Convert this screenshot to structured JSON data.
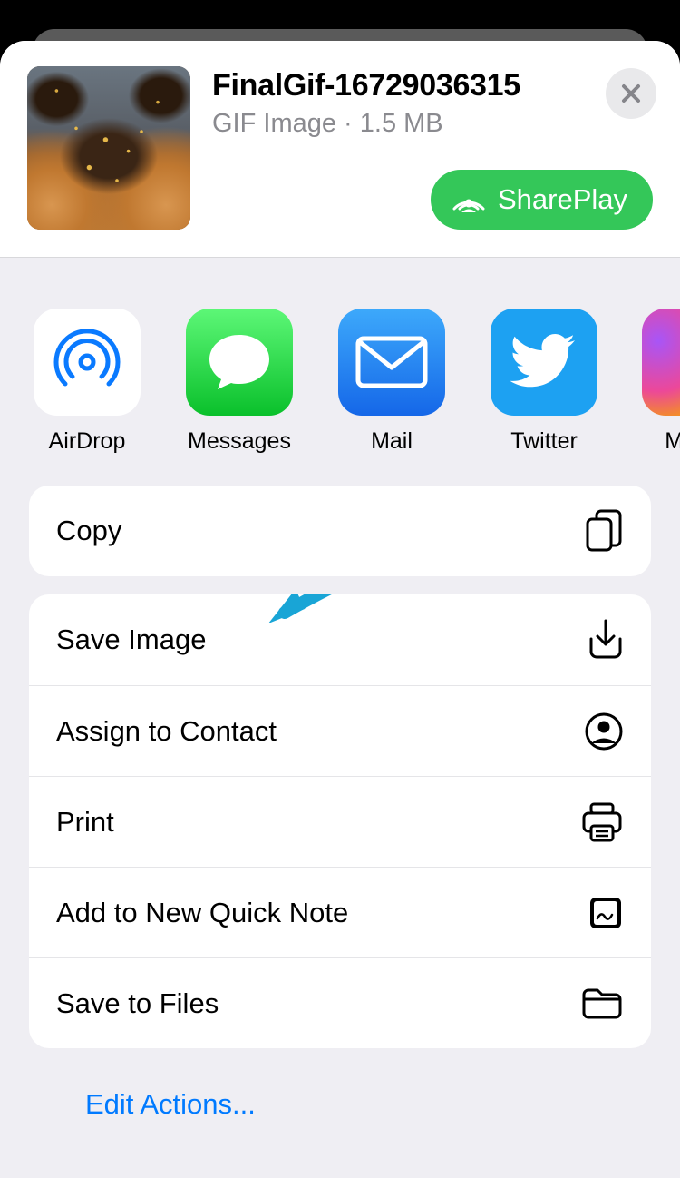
{
  "file": {
    "name": "FinalGif-16729036315",
    "type": "GIF Image",
    "size": "1.5 MB"
  },
  "shareplay_label": "SharePlay",
  "apps": {
    "airdrop": "AirDrop",
    "messages": "Messages",
    "mail": "Mail",
    "twitter": "Twitter",
    "messenger": "Me"
  },
  "actions": {
    "copy": "Copy",
    "save_image": "Save Image",
    "assign_contact": "Assign to Contact",
    "print": "Print",
    "quick_note": "Add to New Quick Note",
    "save_files": "Save to Files"
  },
  "edit_actions": "Edit Actions..."
}
